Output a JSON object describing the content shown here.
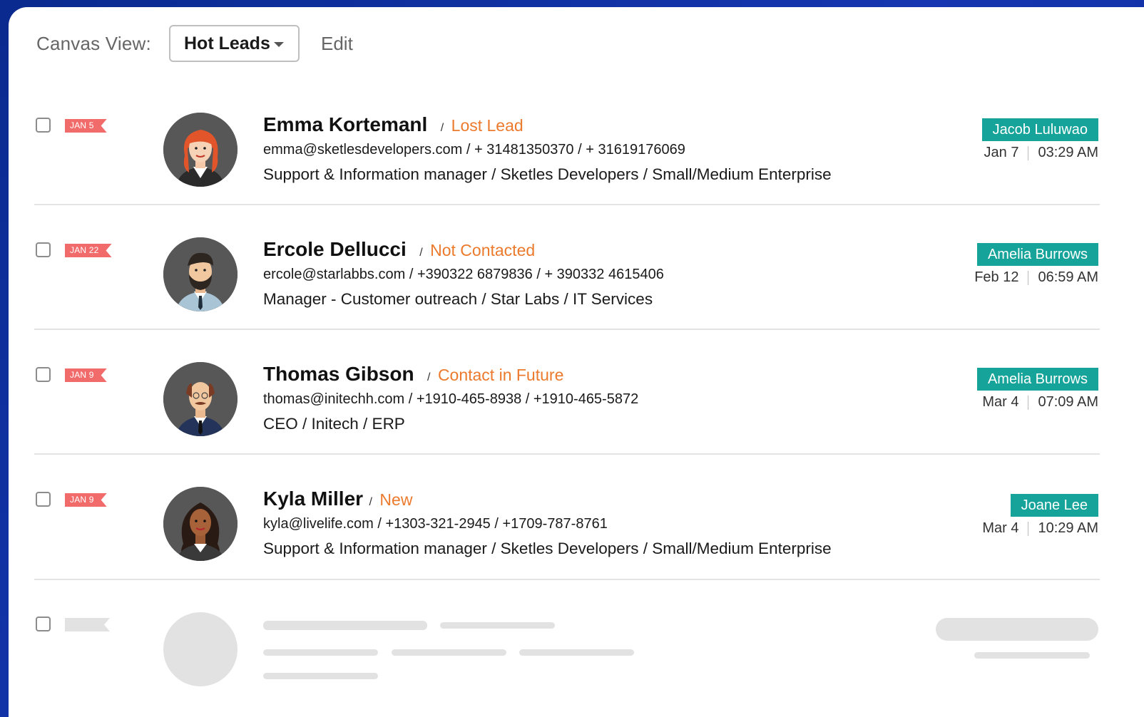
{
  "header": {
    "view_label": "Canvas View:",
    "view_selected": "Hot Leads",
    "edit_label": "Edit"
  },
  "leads": [
    {
      "date_tag": "JAN 5",
      "name": "Emma Kortemanl",
      "status": "Lost Lead",
      "contact": "emma@sketlesdevelopers.com  /  + 31481350370  / + 31619176069",
      "meta": "Support & Information manager  /  Sketles Developers  /  Small/Medium Enterprise",
      "owner": "Jacob Luluwao",
      "date": "Jan 7",
      "time": "03:29 AM"
    },
    {
      "date_tag": "JAN 22",
      "name": "Ercole Dellucci",
      "status": "Not Contacted",
      "contact": "ercole@starlabbs.com  /  +390322 6879836  /  + 390332 4615406",
      "meta": "Manager - Customer outreach  /  Star Labs  /  IT Services",
      "owner": "Amelia Burrows",
      "date": "Feb 12",
      "time": "06:59 AM"
    },
    {
      "date_tag": "JAN 9",
      "name": "Thomas Gibson",
      "status": "Contact in Future",
      "contact": "thomas@initechh.com  /  +1910-465-8938  /  +1910-465-5872",
      "meta": "CEO  /  Initech  /  ERP",
      "owner": "Amelia Burrows",
      "date": "Mar 4",
      "time": "07:09 AM"
    },
    {
      "date_tag": "JAN 9",
      "name": "Kyla Miller",
      "status": "New",
      "contact": "kyla@livelife.com  /  +1303-321-2945  / +1709-787-8761",
      "meta": "Support & Information manager  /  Sketles Developers  /  Small/Medium Enterprise",
      "owner": "Joane Lee",
      "date": "Mar 4",
      "time": "10:29 AM"
    }
  ],
  "colors": {
    "accent_owner": "#16a39a",
    "status": "#ec7a2d",
    "date_tag": "#f26b6b",
    "background": "#1536b0"
  },
  "icons": {
    "checkbox": "checkbox-icon",
    "dropdown": "chevron-down-icon"
  }
}
